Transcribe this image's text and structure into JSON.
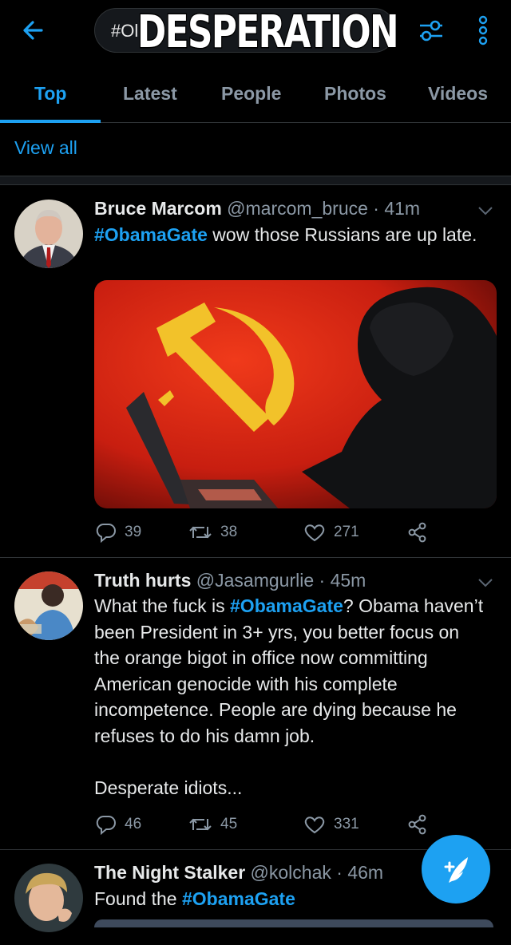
{
  "header": {
    "search_text": "#Ol",
    "overlay_caption": "DESPERATION",
    "icons": [
      "back-arrow-icon",
      "filter-sliders-icon",
      "more-vertical-icon"
    ],
    "accent_color": "#1da1f2"
  },
  "tabs": [
    {
      "label": "Top",
      "active": true
    },
    {
      "label": "Latest",
      "active": false
    },
    {
      "label": "People",
      "active": false
    },
    {
      "label": "Photos",
      "active": false
    },
    {
      "label": "Videos",
      "active": false
    }
  ],
  "view_all": "View all",
  "tweets": [
    {
      "name": "Bruce Marcom",
      "meta": "@marcom_bruce · 41m",
      "body_hashtag": "#ObamaGate",
      "body_text": " wow those Russians are up late.",
      "replies": "39",
      "retweets": "38",
      "likes": "271"
    },
    {
      "name": "Truth hurts",
      "meta": "@Jasamgurlie · 45m",
      "body_pre": "What the fuck is ",
      "body_hashtag": "#ObamaGate",
      "body_post": "? Obama haven’t been President in 3+ yrs, you better focus on the orange bigot in office now committing American genocide with his complete incompetence. People are dying because he refuses to do his damn job.",
      "body_tail": "Desperate idiots...",
      "replies": "46",
      "retweets": "45",
      "likes": "331"
    },
    {
      "name": "The Night Stalker",
      "meta": "@kolchak · 46m",
      "body_pre": "Found the ",
      "body_hashtag": "#ObamaGate"
    }
  ],
  "fab": {
    "icon": "compose-tweet-icon"
  }
}
